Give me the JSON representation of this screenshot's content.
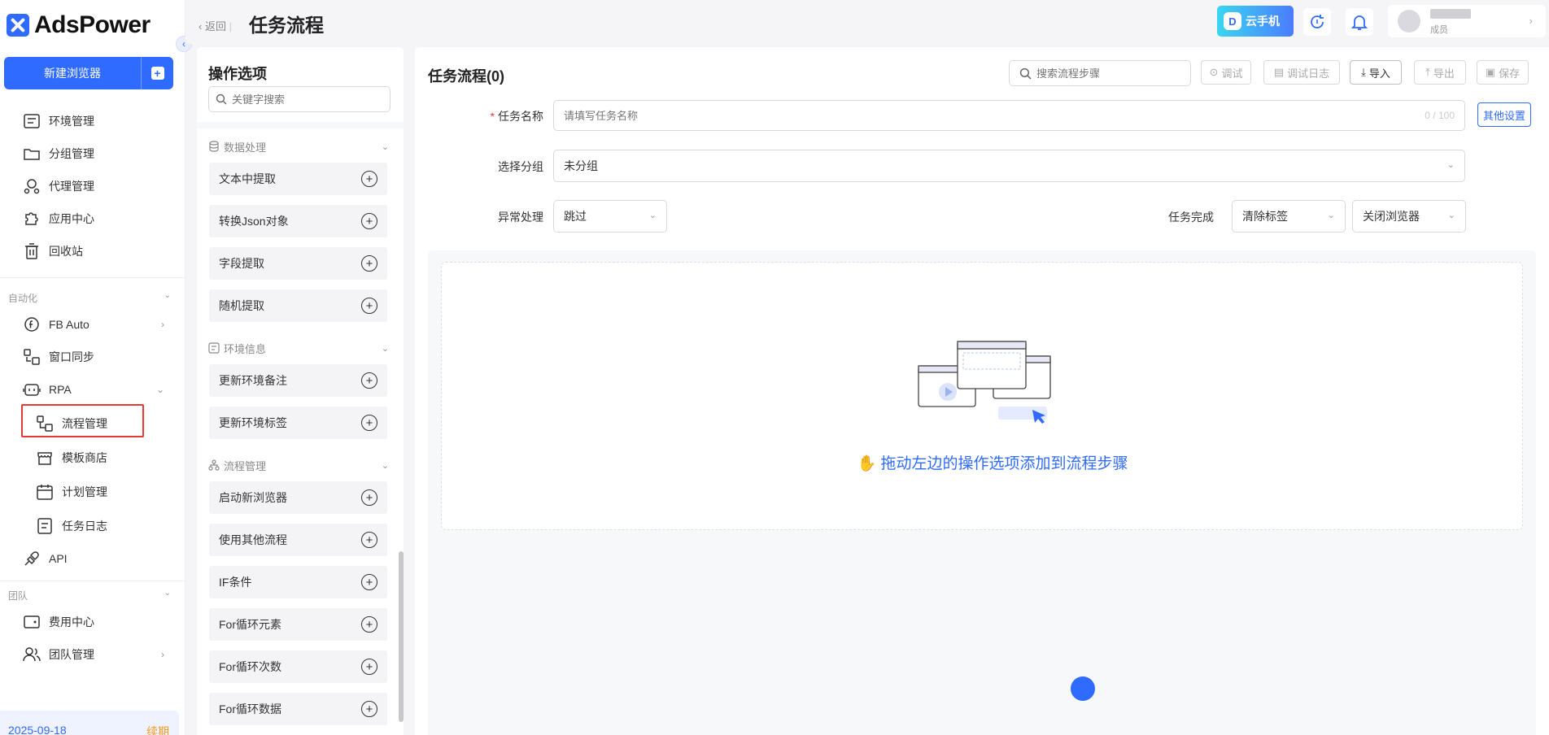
{
  "app": {
    "brand": "AdsPower",
    "new_browser_label": "新建浏览器",
    "new_browser_plus": "+",
    "collapse_icon": "‹",
    "footer_date": "2025-09-18",
    "footer_link": "续期"
  },
  "sidebar": {
    "items": [
      {
        "label": "环境管理",
        "icon": "env-list-icon"
      },
      {
        "label": "分组管理",
        "icon": "folder-icon"
      },
      {
        "label": "代理管理",
        "icon": "proxy-icon"
      },
      {
        "label": "应用中心",
        "icon": "puzzle-icon"
      },
      {
        "label": "回收站",
        "icon": "trash-icon"
      }
    ],
    "section_automation": "自动化",
    "automation_items": [
      {
        "label": "FB Auto",
        "icon": "fb-icon"
      },
      {
        "label": "窗口同步",
        "icon": "sync-icon"
      },
      {
        "label": "RPA",
        "icon": "robot-icon"
      }
    ],
    "rpa_children": [
      {
        "label": "流程管理",
        "icon": "flow-icon"
      },
      {
        "label": "模板商店",
        "icon": "store-icon"
      },
      {
        "label": "计划管理",
        "icon": "calendar-icon"
      },
      {
        "label": "任务日志",
        "icon": "log-icon"
      }
    ],
    "api_label": "API",
    "section_team": "团队",
    "team_items": [
      {
        "label": "费用中心",
        "icon": "wallet-icon"
      },
      {
        "label": "团队管理",
        "icon": "team-icon"
      }
    ]
  },
  "header": {
    "back_label": "返回",
    "title": "任务流程",
    "cloud_phone_label": "云手机",
    "user_role": "成员"
  },
  "options_panel": {
    "title": "操作选项",
    "search_placeholder": "关键字搜索",
    "categories": [
      {
        "name": "数据处理",
        "items": [
          "文本中提取",
          "转换Json对象",
          "字段提取",
          "随机提取"
        ]
      },
      {
        "name": "环境信息",
        "items": [
          "更新环境备注",
          "更新环境标签"
        ]
      },
      {
        "name": "流程管理",
        "items": [
          "启动新浏览器",
          "使用其他流程",
          "IF条件",
          "For循环元素",
          "For循环次数",
          "For循环数据"
        ]
      }
    ]
  },
  "main": {
    "title": "任务流程(0)",
    "search_placeholder": "搜索流程步骤",
    "toolbar": {
      "debug": "调试",
      "debug_log": "调试日志",
      "import": "导入",
      "export": "导出",
      "save": "保存"
    },
    "form": {
      "task_name_label": "任务名称",
      "task_name_placeholder": "请填写任务名称",
      "task_name_count": "0 / 100",
      "other_settings": "其他设置",
      "group_label": "选择分组",
      "group_value": "未分组",
      "exception_label": "异常处理",
      "exception_value": "跳过",
      "completion_label": "任务完成",
      "completion_clear": "清除标签",
      "completion_close": "关闭浏览器"
    },
    "empty_hint": "拖动左边的操作选项添加到流程步骤"
  },
  "colors": {
    "accent": "#2f6bff",
    "highlight_border": "#e53935",
    "footer_link": "#f59b23"
  }
}
